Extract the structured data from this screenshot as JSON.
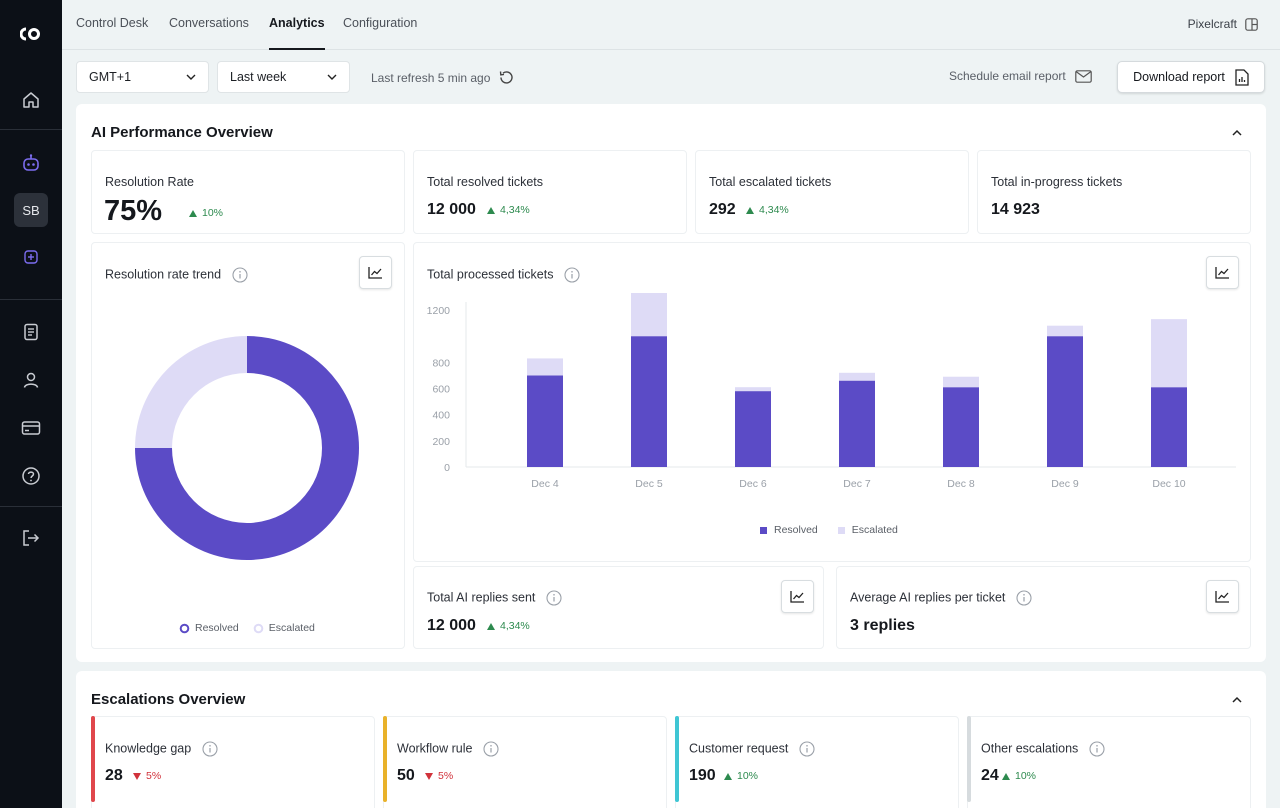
{
  "sidebar": {
    "avatar_initials": "SB",
    "items": [
      {
        "icon": "home-icon"
      },
      {
        "icon": "bot-icon"
      },
      {
        "icon": "add-square-icon"
      },
      {
        "icon": "document-icon"
      },
      {
        "icon": "user-icon"
      },
      {
        "icon": "credit-card-icon"
      },
      {
        "icon": "help-icon"
      },
      {
        "icon": "logout-icon"
      }
    ]
  },
  "nav": {
    "tabs": [
      {
        "label": "Control Desk"
      },
      {
        "label": "Conversations"
      },
      {
        "label": "Analytics",
        "active": true
      },
      {
        "label": "Configuration"
      }
    ],
    "brand": "Pixelcraft"
  },
  "toolbar": {
    "timezone": "GMT+1",
    "period": "Last week",
    "last_refresh": "Last refresh 5 min ago",
    "schedule_label": "Schedule email report",
    "download_label": "Download report"
  },
  "ai_overview": {
    "title": "AI Performance Overview",
    "resolution_rate": {
      "label": "Resolution Rate",
      "value": "75%",
      "change": "10%"
    },
    "resolved": {
      "label": "Total resolved tickets",
      "value": "12 000",
      "change": "4,34%"
    },
    "escalated": {
      "label": "Total escalated tickets",
      "value": "292",
      "change": "4,34%"
    },
    "in_progress": {
      "label": "Total in-progress tickets",
      "value": "14 923"
    },
    "donut_card": {
      "title": "Resolution rate trend",
      "legend_resolved": "Resolved",
      "legend_escalated": "Escalated"
    },
    "bar_card": {
      "title": "Total processed tickets",
      "legend_resolved": "Resolved",
      "legend_escalated": "Escalated"
    },
    "replies": {
      "label": "Total AI replies sent",
      "value": "12 000",
      "change": "4,34%"
    },
    "avg_replies": {
      "label": "Average AI replies per ticket",
      "value": "3 replies"
    }
  },
  "escalations": {
    "title": "Escalations Overview",
    "cards": [
      {
        "label": "Knowledge gap",
        "value": "28",
        "change": "5%",
        "direction": "down",
        "accent": "#e0474c"
      },
      {
        "label": "Workflow rule",
        "value": "50",
        "change": "5%",
        "direction": "down",
        "accent": "#e9b22a"
      },
      {
        "label": "Customer request",
        "value": "190",
        "change": "10%",
        "direction": "up",
        "accent": "#3fc6d4"
      },
      {
        "label": "Other escalations",
        "value": "24",
        "change": "10%",
        "direction": "up",
        "accent": "#d6dbde"
      }
    ]
  },
  "colors": {
    "resolved": "#5b4bc6",
    "escalated": "#dedbf6"
  },
  "chart_data": [
    {
      "type": "pie",
      "title": "Resolution rate trend",
      "categories": [
        "Resolved",
        "Escalated"
      ],
      "values": [
        75,
        25
      ]
    },
    {
      "type": "bar",
      "title": "Total processed tickets",
      "categories": [
        "Dec 4",
        "Dec 5",
        "Dec 6",
        "Dec 7",
        "Dec 8",
        "Dec 9",
        "Dec 10"
      ],
      "series": [
        {
          "name": "Resolved",
          "values": [
            700,
            1000,
            580,
            660,
            610,
            1000,
            610
          ]
        },
        {
          "name": "Escalated",
          "values": [
            130,
            380,
            30,
            60,
            80,
            80,
            520
          ]
        }
      ],
      "yticks": [
        0,
        200,
        400,
        600,
        800,
        1200
      ],
      "stacked": true
    }
  ]
}
